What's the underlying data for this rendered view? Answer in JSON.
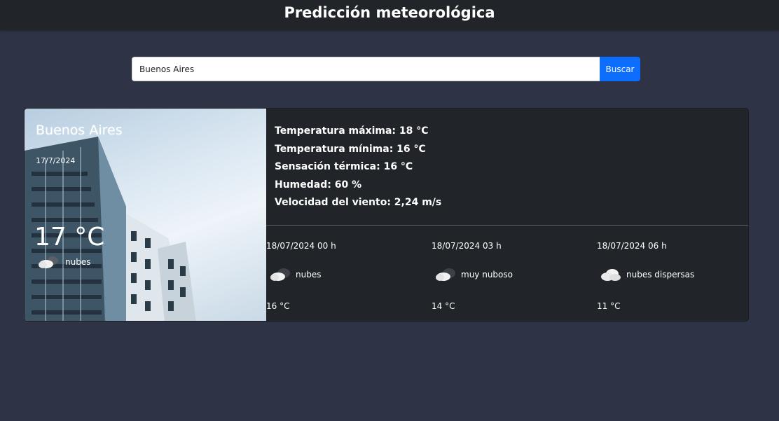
{
  "header": {
    "title": "Predicción meteorológica"
  },
  "search": {
    "value": "Buenos Aires",
    "button_label": "Buscar"
  },
  "current": {
    "city": "Buenos Aires",
    "date": "17/7/2024",
    "temperature": "17 °C",
    "condition": "nubes",
    "condition_icon": "cloud-icon"
  },
  "details": {
    "max_temp": "Temperatura máxima: 18 °C",
    "min_temp": "Temperatura mínima: 16 °C",
    "feels_like": "Sensación térmica: 16 °C",
    "humidity": "Humedad: 60 %",
    "wind": "Velocidad del viento: 2,24 m/s"
  },
  "forecast": [
    {
      "datetime": "18/07/2024 00 h",
      "condition": "nubes",
      "temperature": "16 °C",
      "icon": "dark-cloud-icon"
    },
    {
      "datetime": "18/07/2024 03 h",
      "condition": "muy nuboso",
      "temperature": "14 °C",
      "icon": "dark-cloud-icon"
    },
    {
      "datetime": "18/07/2024 06 h",
      "condition": "nubes dispersas",
      "temperature": "11 °C",
      "icon": "cloud-icon"
    }
  ],
  "colors": {
    "page_bg": "#2e3345",
    "header_bg": "#212529",
    "card_bg": "#212529",
    "button_bg": "#0d6efd"
  }
}
